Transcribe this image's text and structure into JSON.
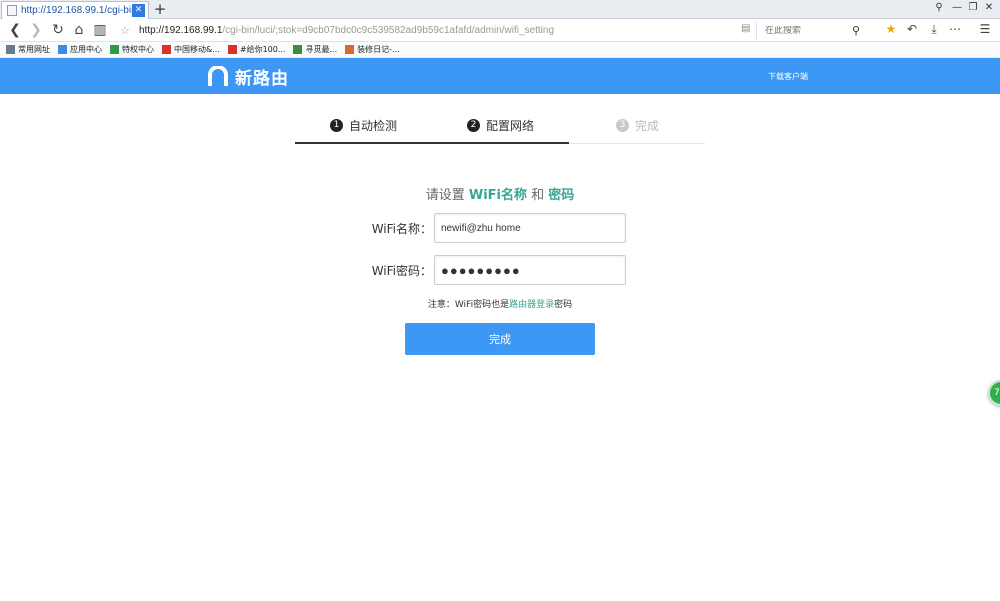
{
  "browser": {
    "tab": {
      "title": "http://192.168.99.1/cgi-bin/l",
      "close_label": "✕"
    },
    "new_tab_label": "+",
    "window_controls": [
      "⚲",
      "—",
      "❐",
      "✕"
    ],
    "url": {
      "host": "http://192.168.99.1",
      "path": "/cgi-bin/luci/;stok=d9cb07bdc0c9c539582ad9b59c1afafd/admin/wifi_setting"
    },
    "search_placeholder": "在此搜索",
    "bookmarks": [
      {
        "label": "常用网址",
        "icon": "folder-icon",
        "color": "#6b7b8c"
      },
      {
        "label": "应用中心",
        "icon": "app-icon",
        "color": "#3d8be0"
      },
      {
        "label": "特权中心",
        "icon": "privilege-icon",
        "color": "#2a9d4a"
      },
      {
        "label": "中国移动&...",
        "icon": "jd-icon",
        "color": "#d9322a"
      },
      {
        "label": "#给你100...",
        "icon": "jd-icon",
        "color": "#d9322a"
      },
      {
        "label": "寻觅最...",
        "icon": "leaf-icon",
        "color": "#3a8f3a"
      },
      {
        "label": "装修日记-...",
        "icon": "diary-icon",
        "color": "#d86a2a"
      }
    ]
  },
  "site": {
    "logo_text": "新路由",
    "download_client": "下载客户端",
    "brand_color": "#3d97f5",
    "accent_color": "#3aa594"
  },
  "steps": [
    {
      "num": "1",
      "label": "自动检测",
      "state": "done"
    },
    {
      "num": "2",
      "label": "配置网络",
      "state": "active"
    },
    {
      "num": "3",
      "label": "完成",
      "state": "pending"
    }
  ],
  "form": {
    "title_prefix": "请设置 ",
    "title_hl1": "WiFi名称",
    "title_mid": " 和 ",
    "title_hl2": "密码",
    "ssid_label": "WiFi名称：",
    "ssid_value": "newifi@zhu home",
    "password_label": "WiFi密码：",
    "password_value": "●●●●●●●●●",
    "note_prefix": "注意：WiFi密码也是",
    "note_link": "路由器登录",
    "note_suffix": "密码",
    "submit_label": "完成"
  },
  "float_widget_label": "72"
}
